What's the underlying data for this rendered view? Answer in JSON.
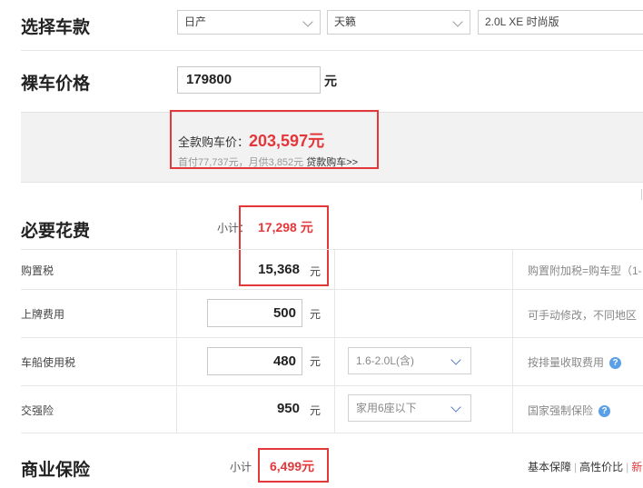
{
  "select_car": {
    "title": "选择车款",
    "brand": "日产",
    "model": "天籁",
    "trim": "2.0L XE 时尚版"
  },
  "bare_price": {
    "title": "裸车价格",
    "value": "179800",
    "unit": "元"
  },
  "summary": {
    "full_label": "全款购车价：",
    "full_value": "203,597元",
    "loan_info": "首付77,737元，月供3,852元",
    "loan_link": "贷款购车>>"
  },
  "required": {
    "title": "必要花费",
    "subtotal_label": "小计：",
    "subtotal_value": "17,298 元",
    "rows": [
      {
        "label": "购置税",
        "value": "15,368",
        "unit": "元",
        "note": "购置附加税=购车型（1-"
      },
      {
        "label": "上牌费用",
        "value": "500",
        "unit": "元",
        "note": "可手动修改，不同地区"
      },
      {
        "label": "车船使用税",
        "value": "480",
        "unit": "元",
        "option": "1.6-2.0L(含)",
        "note": "按排量收取费用"
      },
      {
        "label": "交强险",
        "value": "950",
        "unit": "元",
        "option": "家用6座以下",
        "note": "国家强制保险"
      }
    ]
  },
  "commercial": {
    "title": "商业保险",
    "subtotal_label": "小计",
    "subtotal_value": "6,499元",
    "links": [
      "基本保障",
      "高性价比",
      "新"
    ]
  },
  "colors": {
    "accent_red": "#e3373a",
    "help_blue": "#5aa0e6",
    "panel_gray": "#f2f2f2"
  }
}
